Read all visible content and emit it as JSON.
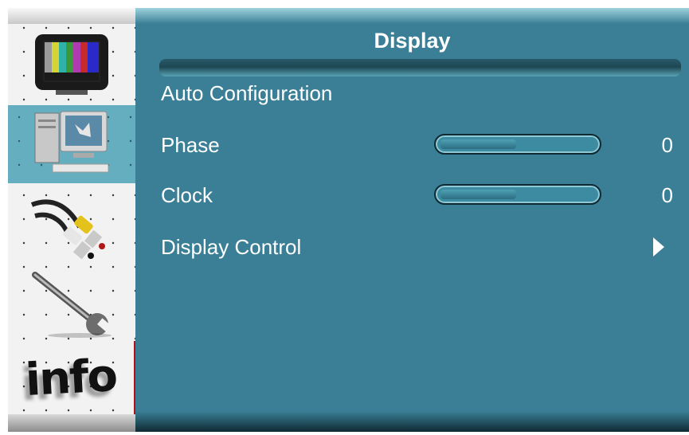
{
  "panel": {
    "title": "Display",
    "items": [
      {
        "label": "Auto Configuration"
      },
      {
        "label": "Phase",
        "value": "0",
        "level": 0
      },
      {
        "label": "Clock",
        "value": "0",
        "level": 0
      },
      {
        "label": "Display Control"
      }
    ]
  },
  "sidebar": {
    "items": [
      {
        "icon": "tv-color-bars-icon"
      },
      {
        "icon": "computer-icon",
        "selected": true
      },
      {
        "icon": "av-cable-icon"
      },
      {
        "icon": "wrench-icon"
      },
      {
        "icon": "info-icon",
        "text": "info"
      }
    ]
  },
  "colors": {
    "panel_bg": "#3a7f96",
    "selected_bg": "#64aec0",
    "sidebar_bg": "#f2f2f2",
    "text": "#ffffff",
    "info_border": "#b0101a"
  }
}
